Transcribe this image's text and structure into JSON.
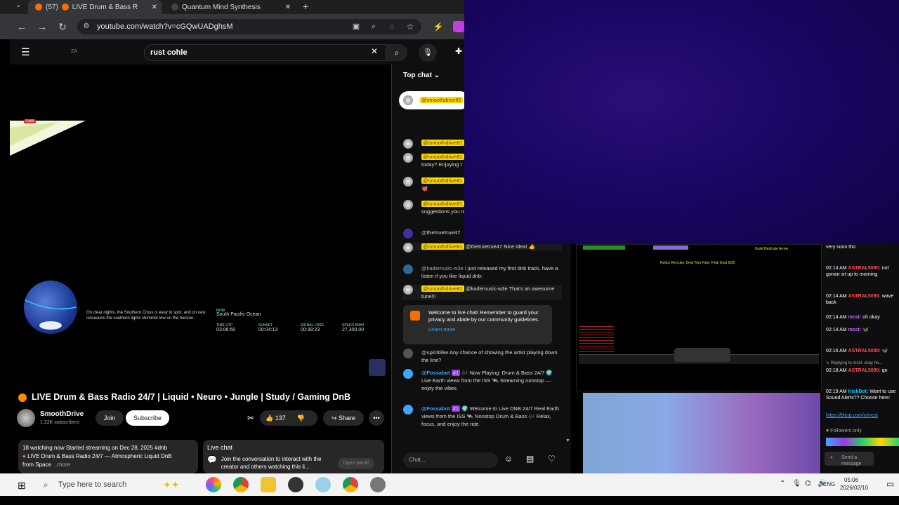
{
  "browser": {
    "tab1_count": "(57)",
    "tab1_title": "LIVE Drum & Bass R",
    "tab2_title": "Quantum Mind Synthesis",
    "url": "youtube.com/watch?v=cGQwUADghsM"
  },
  "youtube": {
    "logo_text": "ZA",
    "search_value": "rust cohle",
    "video_overlay": {
      "live_badge": "Live",
      "caption": "On clear nights, the Southern Cross is easy to spot, and on rare occasions the southern lights shimmer low on the horizon.",
      "now_label": "NOW",
      "location": "South Pacific Ocean",
      "time_utc_label": "TIME UTC",
      "time_utc": "03:06:50",
      "sunset_label": "SUNSET",
      "sunset": "00:04:13",
      "signal_loss_label": "SIGNAL LOSS",
      "signal_loss": "00:39:23",
      "speed_label": "SPEED KM/H",
      "speed": "27,300.00"
    },
    "title": "LIVE Drum & Bass Radio 24/7 | Liquid • Neuro • Jungle | Study / Gaming DnB",
    "channel": "SmoothDrive",
    "subscribers": "1.22K subscribers",
    "join_label": "Join",
    "subscribe_label": "Subscribe",
    "likes": "137",
    "share_label": "Share",
    "description_line1": "18 watching now  Started streaming on Dec 28, 2025  #dnb",
    "description_line2": "LIVE Drum & Bass Radio 24/7 — Atmospheric Liquid DnB",
    "description_line3": "from Space",
    "description_more": "...more",
    "livechat_title": "Live chat",
    "livechat_text": "Join the conversation to interact with the creator and others watching this li...",
    "open_panel": "Open panel"
  },
  "chat": {
    "header": "Top chat",
    "pinned_name": "@smoothdrive81",
    "messages": [
      {
        "name": "@smoothdrive81",
        "text": "",
        "style": "yellow"
      },
      {
        "name": "@smoothdrive81",
        "text": "today? Enjoying t",
        "style": "yellow"
      },
      {
        "name": "@smoothdrive81",
        "text": "",
        "style": "yellow"
      },
      {
        "name": "@smoothdrive81",
        "text": "suggestions you really much appr",
        "style": "yellow"
      },
      {
        "name": "@thetruetrue47",
        "text": "",
        "style": "gray"
      },
      {
        "name": "@smoothdrive81",
        "text": "@thetruetrue47 Nice idea! 👍",
        "style": "yellow"
      },
      {
        "name": "@kademusic-w3e",
        "text": "I just released my first dnb track, have a listen if you like liquid dnb:",
        "style": "gray"
      },
      {
        "name": "@smoothdrive81",
        "text": "@kademusic-w3e That's an awesome tune!!!",
        "style": "yellow"
      }
    ],
    "welcome": "Welcome to live chat! Remember to guard your privacy and abide by our community guidelines.",
    "learn_more": "Learn more",
    "late_messages": [
      {
        "name": "@spiritlike",
        "text": "Any chance of showing the artist playing down the line?"
      },
      {
        "name": "@Fossabot",
        "badge": "#1",
        "text": "🎶 Now Playing: Drum & Bass 24/7 🌍 Live Earth views from the ISS 🛰️ Streaming nonstop — enjoy the vibes"
      },
      {
        "name": "@Fossabot",
        "badge": "#1",
        "text": "🌍 Welcome to Live DNB 24/7 Real Earth views from the ISS 🛰️ Nonstop Drum & Bass 🎶 Relax, focus, and enjoy the ride"
      }
    ],
    "input_placeholder": "Chat..."
  },
  "game": {
    "status": "Notice Recruits: Deal Your Fate: Final Goal 8/25",
    "side_text": "Guild Dedicate Arrow"
  },
  "twitch": {
    "lines": [
      {
        "time": "",
        "name": "",
        "text": "very soon tho"
      },
      {
        "time": "02:14 AM",
        "name": "ASTRAL5090:",
        "text": "not gonan sit up to morning"
      },
      {
        "time": "02:14 AM",
        "name": "ASTRAL5090:",
        "text": "wave back"
      },
      {
        "time": "02:14 AM",
        "name": "mcst:",
        "text": "oh okay"
      },
      {
        "time": "02:14 AM",
        "name": "mcst:",
        "text": ""
      },
      {
        "time": "02:16 AM",
        "name": "ASTRAL5090:",
        "text": ""
      },
      {
        "time": "",
        "name": "",
        "text": "Replying to mcst: okay he..."
      },
      {
        "time": "02:18 AM",
        "name": "ASTRAL5090:",
        "text": "gn"
      },
      {
        "time": "02:19 AM",
        "name": "KickBot:",
        "text": "Want to use Sound Alerts?? Choose here:"
      },
      {
        "time": "",
        "name": "",
        "text": "https://blerp.com/x/mcst"
      }
    ],
    "followers_only": "Followers only",
    "send": "Send a message"
  },
  "taskbar": {
    "search_placeholder": "Type here to search",
    "lang": "ENG",
    "time": "05:06",
    "date": "2026/02/10"
  }
}
